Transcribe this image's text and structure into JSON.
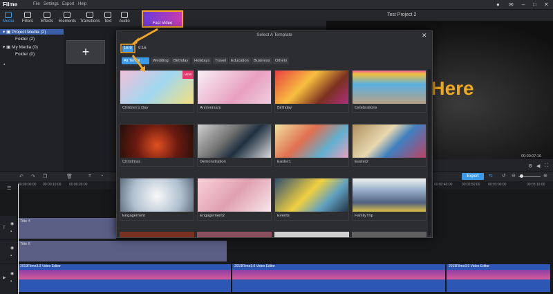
{
  "app": {
    "name": "Filme",
    "menu": [
      "File",
      "Settings",
      "Export",
      "Help"
    ]
  },
  "toolbar": {
    "items": [
      {
        "label": "Media",
        "icon": "media-icon"
      },
      {
        "label": "Filters",
        "icon": "filters-icon"
      },
      {
        "label": "Effects",
        "icon": "effects-icon"
      },
      {
        "label": "Elements",
        "icon": "elements-icon"
      },
      {
        "label": "Transitions",
        "icon": "transitions-icon"
      },
      {
        "label": "Text",
        "icon": "text-icon"
      },
      {
        "label": "Audio",
        "icon": "audio-icon"
      }
    ],
    "fast_video": "Fast Video"
  },
  "sidebar": {
    "tree": [
      {
        "label": "Project Media (2)"
      },
      {
        "label": "Folder (2)"
      },
      {
        "label": "My Media (0)"
      },
      {
        "label": "Folder (0)"
      }
    ]
  },
  "preview": {
    "title": "Test Project 2",
    "overlay_text": "s Here",
    "time": "00:00:07:16"
  },
  "timeline": {
    "export_label": "Export",
    "ruler": [
      "00:00:00:00",
      "00:00:10:00",
      "00:00:20:00",
      "00:02:40:00",
      "00:02:50:00",
      "00:03:00:00",
      "00:03:10:00"
    ],
    "tracks": [
      {
        "clip": "Title 4"
      },
      {
        "clip": "Title 6"
      },
      {
        "clip": "2019Filme3.0 Video Editor"
      }
    ],
    "video_clips": [
      "2019Filme3.0 Video Editor",
      "2019Filme3.0 Video Editor",
      "2019Filme3.0 Video Editor"
    ]
  },
  "modal": {
    "title": "Select A Template",
    "ratios": [
      "16:9",
      "9:16"
    ],
    "categories": [
      "All Templ",
      "Wedding",
      "Birthday",
      "Holidays",
      "Travel",
      "Education",
      "Business",
      "Others"
    ],
    "templates": [
      {
        "label": "Children's Day",
        "badge": "NEW"
      },
      {
        "label": "Anniversary"
      },
      {
        "label": "Birthday"
      },
      {
        "label": "Celebrations"
      },
      {
        "label": "Christmas"
      },
      {
        "label": "Demonstration"
      },
      {
        "label": "Easter1"
      },
      {
        "label": "Easter2"
      },
      {
        "label": "Engagement"
      },
      {
        "label": "Engagement2"
      },
      {
        "label": "Events"
      },
      {
        "label": "FamilyTrip"
      }
    ]
  },
  "colors": {
    "accent": "#3d9ae8",
    "highlight": "#f5a623",
    "clip_title": "#5b5f86",
    "clip_video": "#2d57b5"
  }
}
